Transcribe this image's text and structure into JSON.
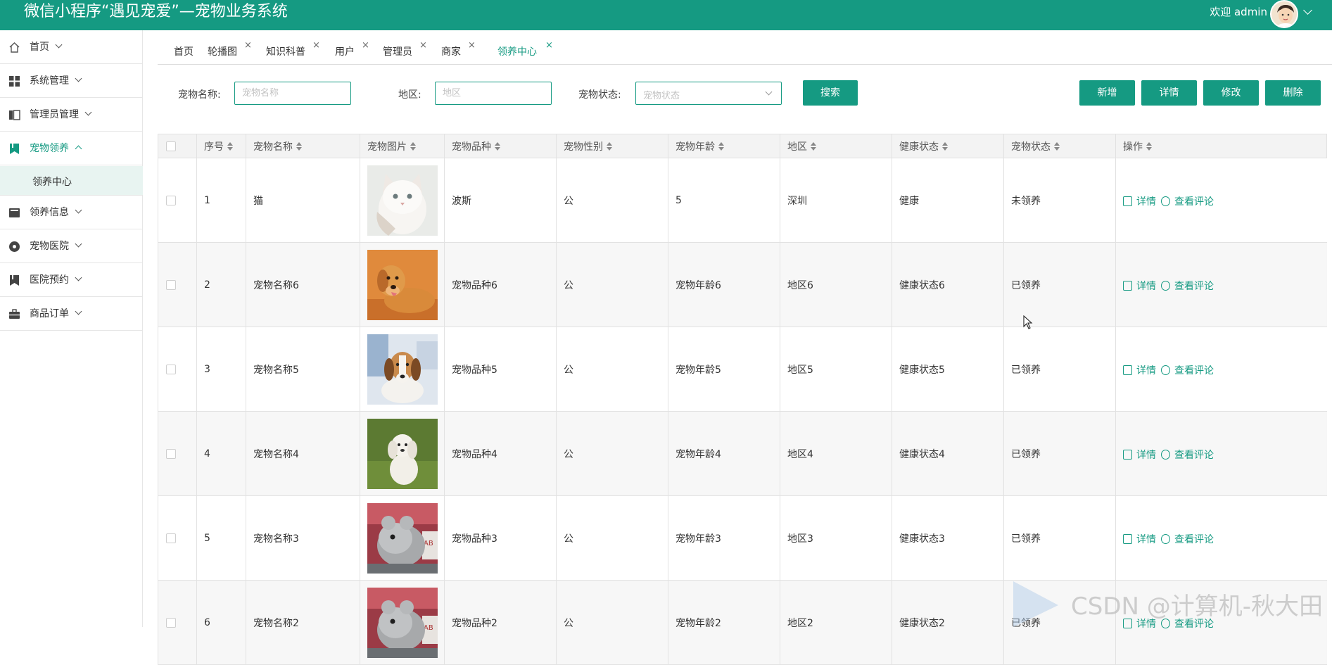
{
  "app": {
    "title": "微信小程序“遇见宠爱”—宠物业务系统",
    "welcome": "欢迎 admin"
  },
  "sidebar": {
    "items": [
      {
        "label": "首页",
        "icon": "home-icon"
      },
      {
        "label": "系统管理",
        "icon": "grid-icon"
      },
      {
        "label": "管理员管理",
        "icon": "columns-icon"
      },
      {
        "label": "宠物领养",
        "icon": "bookmark-icon",
        "active": true
      },
      {
        "label": "领养信息",
        "icon": "card-icon"
      },
      {
        "label": "宠物医院",
        "icon": "circle-dot-icon"
      },
      {
        "label": "医院预约",
        "icon": "bookmark-icon"
      },
      {
        "label": "商品订单",
        "icon": "briefcase-icon"
      }
    ],
    "sub_item": "领养中心"
  },
  "tabs": [
    {
      "label": "首页",
      "closable": false
    },
    {
      "label": "轮播图",
      "closable": true
    },
    {
      "label": "知识科普",
      "closable": true
    },
    {
      "label": "用户",
      "closable": true
    },
    {
      "label": "管理员",
      "closable": true
    },
    {
      "label": "商家",
      "closable": true
    },
    {
      "label": "领养中心",
      "closable": true,
      "active": true
    }
  ],
  "tab_close_glyph": "×",
  "search": {
    "name_label": "宠物名称:",
    "name_placeholder": "宠物名称",
    "region_label": "地区:",
    "region_placeholder": "地区",
    "status_label": "宠物状态:",
    "status_placeholder": "宠物状态",
    "search_button": "搜索"
  },
  "actions": {
    "add": "新增",
    "detail": "详情",
    "edit": "修改",
    "delete": "删除"
  },
  "table": {
    "headers": [
      "序号",
      "宠物名称",
      "宠物图片",
      "宠物品种",
      "宠物性别",
      "宠物年龄",
      "地区",
      "健康状态",
      "宠物状态",
      "操作"
    ],
    "rows": [
      {
        "no": "1",
        "name": "猫",
        "breed": "波斯",
        "gender": "公",
        "age": "5",
        "region": "深圳",
        "health": "健康",
        "status": "未领养",
        "image": "white-cat"
      },
      {
        "no": "2",
        "name": "宠物名称6",
        "breed": "宠物品种6",
        "gender": "公",
        "age": "宠物年龄6",
        "region": "地区6",
        "health": "健康状态6",
        "status": "已领养",
        "image": "golden-retriever"
      },
      {
        "no": "3",
        "name": "宠物名称5",
        "breed": "宠物品种5",
        "gender": "公",
        "age": "宠物年龄5",
        "region": "地区5",
        "health": "健康状态5",
        "status": "已领养",
        "image": "beagle"
      },
      {
        "no": "4",
        "name": "宠物名称4",
        "breed": "宠物品种4",
        "gender": "公",
        "age": "宠物年龄4",
        "region": "地区4",
        "health": "健康状态4",
        "status": "已领养",
        "image": "white-puppy-on-grass"
      },
      {
        "no": "5",
        "name": "宠物名称3",
        "breed": "宠物品种3",
        "gender": "公",
        "age": "宠物年龄3",
        "region": "地区3",
        "health": "健康状态3",
        "status": "已领养",
        "image": "chinchilla"
      },
      {
        "no": "6",
        "name": "宠物名称2",
        "breed": "宠物品种2",
        "gender": "公",
        "age": "宠物年龄2",
        "region": "地区2",
        "health": "健康状态2",
        "status": "已领养",
        "image": "chinchilla"
      }
    ],
    "row_actions": {
      "detail": "详情",
      "comments": "查看评论"
    }
  },
  "watermark": "CSDN @计算机-秋大田",
  "colors": {
    "primary": "#159a82",
    "sub_active_bg": "#e8f4f1"
  }
}
